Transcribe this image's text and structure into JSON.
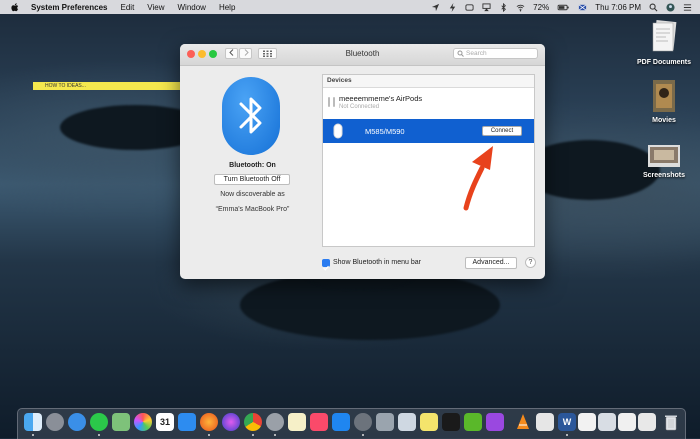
{
  "menubar": {
    "app_name": "System Preferences",
    "menus": [
      "Edit",
      "View",
      "Window",
      "Help"
    ],
    "battery": "72%",
    "clock": "Thu 7:06 PM"
  },
  "sticky_note": {
    "text": "HOW TO IDEAS..."
  },
  "desktop_icons": [
    {
      "label": "PDF Documents"
    },
    {
      "label": "Movies"
    },
    {
      "label": "Screenshots"
    }
  ],
  "window": {
    "title": "Bluetooth",
    "search_placeholder": "Search",
    "bluetooth_status": "Bluetooth: On",
    "toggle_button": "Turn Bluetooth Off",
    "discoverable_line1": "Now discoverable as",
    "discoverable_line2": "“Emma's MacBook Pro”",
    "devices_header": "Devices",
    "devices": [
      {
        "name": "meeeemmeme's AirPods",
        "status": "Not Connected"
      },
      {
        "name": "M585/M590",
        "action": "Connect"
      }
    ],
    "show_in_menubar_label": "Show Bluetooth in menu bar",
    "show_in_menubar_checked": true,
    "advanced_button": "Advanced...",
    "help_button": "?"
  },
  "colors": {
    "accent": "#1060d0",
    "arrow": "#e8421c",
    "bluetooth_logo": "#1a7ae0"
  },
  "dock": {
    "apps": [
      "Finder",
      "Launchpad",
      "Safari",
      "Messages",
      "Maps",
      "Photos",
      "Calendar",
      "App Store",
      "Firefox",
      "Chrome",
      "Preferences",
      "Music",
      "Terminal",
      "Word",
      "Trash"
    ],
    "calendar_day": "31",
    "word_badge": "W"
  }
}
